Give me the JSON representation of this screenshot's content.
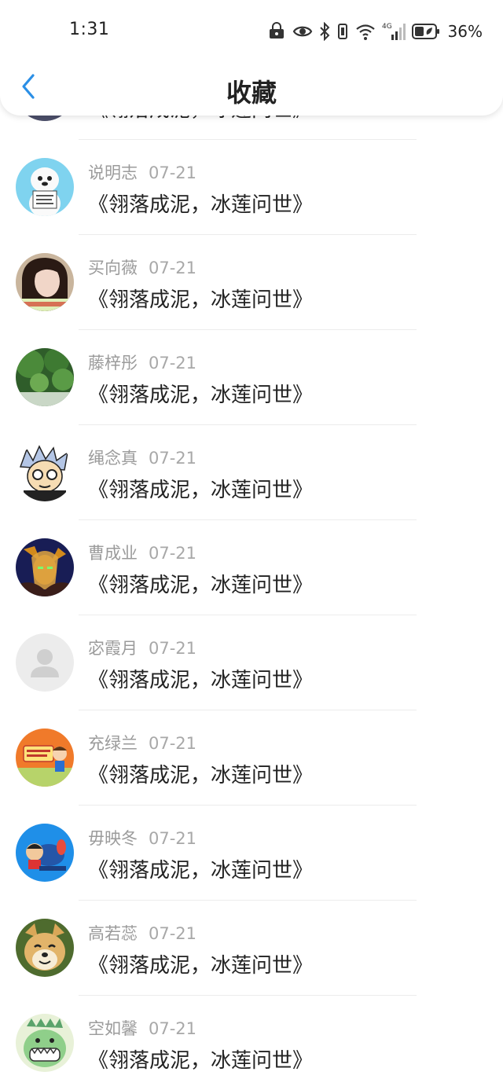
{
  "status_bar": {
    "time": "1:31",
    "network": "4G",
    "battery": "36%"
  },
  "header": {
    "title": "收藏",
    "back_icon": "chevron-left-icon",
    "accent_color": "#2b8fe6"
  },
  "items": [
    {
      "name": "",
      "date": "",
      "title": "《翎落成泥，冰莲问世》",
      "avatar": "avatar-partial"
    },
    {
      "name": "说明志",
      "date": "07-21",
      "title": "《翎落成泥，冰莲问世》",
      "avatar": "avatar-white-dog"
    },
    {
      "name": "买向薇",
      "date": "07-21",
      "title": "《翎落成泥，冰莲问世》",
      "avatar": "avatar-girl"
    },
    {
      "name": "藤梓彤",
      "date": "07-21",
      "title": "《翎落成泥，冰莲问世》",
      "avatar": "avatar-trees"
    },
    {
      "name": "绳念真",
      "date": "07-21",
      "title": "《翎落成泥，冰莲问世》",
      "avatar": "avatar-anime-boy"
    },
    {
      "name": "曹成业",
      "date": "07-21",
      "title": "《翎落成泥，冰莲问世》",
      "avatar": "avatar-elf"
    },
    {
      "name": "宓霞月",
      "date": "07-21",
      "title": "《翎落成泥，冰莲问世》",
      "avatar": "avatar-default"
    },
    {
      "name": "充绿兰",
      "date": "07-21",
      "title": "《翎落成泥，冰莲问世》",
      "avatar": "avatar-cartoon-orange"
    },
    {
      "name": "毋映冬",
      "date": "07-21",
      "title": "《翎落成泥，冰莲问世》",
      "avatar": "avatar-cartoon-blue"
    },
    {
      "name": "高若蕊",
      "date": "07-21",
      "title": "《翎落成泥，冰莲问世》",
      "avatar": "avatar-shiba"
    },
    {
      "name": "空如馨",
      "date": "07-21",
      "title": "《翎落成泥，冰莲问世》",
      "avatar": "avatar-dino"
    }
  ]
}
